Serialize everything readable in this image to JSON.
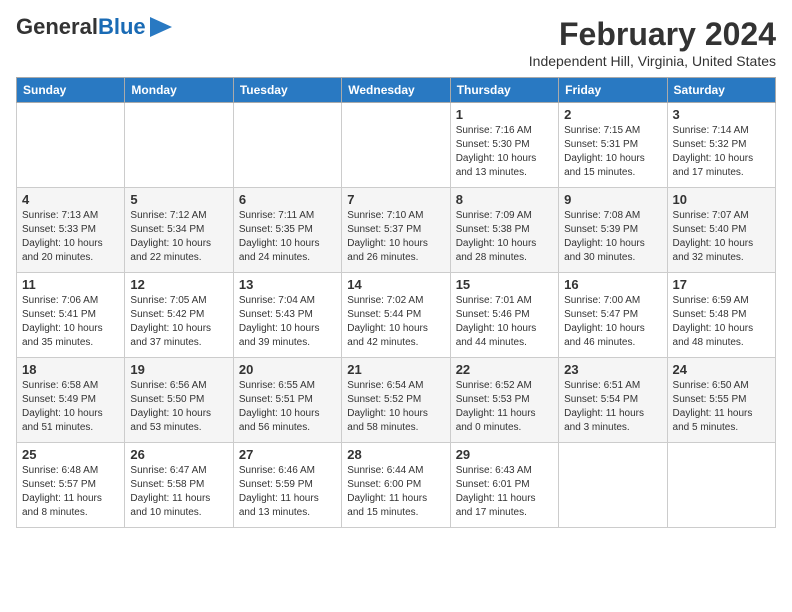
{
  "header": {
    "logo_general": "General",
    "logo_blue": "Blue",
    "month_title": "February 2024",
    "location": "Independent Hill, Virginia, United States"
  },
  "days_of_week": [
    "Sunday",
    "Monday",
    "Tuesday",
    "Wednesday",
    "Thursday",
    "Friday",
    "Saturday"
  ],
  "weeks": [
    [
      {
        "day": "",
        "info": ""
      },
      {
        "day": "",
        "info": ""
      },
      {
        "day": "",
        "info": ""
      },
      {
        "day": "",
        "info": ""
      },
      {
        "day": "1",
        "info": "Sunrise: 7:16 AM\nSunset: 5:30 PM\nDaylight: 10 hours\nand 13 minutes."
      },
      {
        "day": "2",
        "info": "Sunrise: 7:15 AM\nSunset: 5:31 PM\nDaylight: 10 hours\nand 15 minutes."
      },
      {
        "day": "3",
        "info": "Sunrise: 7:14 AM\nSunset: 5:32 PM\nDaylight: 10 hours\nand 17 minutes."
      }
    ],
    [
      {
        "day": "4",
        "info": "Sunrise: 7:13 AM\nSunset: 5:33 PM\nDaylight: 10 hours\nand 20 minutes."
      },
      {
        "day": "5",
        "info": "Sunrise: 7:12 AM\nSunset: 5:34 PM\nDaylight: 10 hours\nand 22 minutes."
      },
      {
        "day": "6",
        "info": "Sunrise: 7:11 AM\nSunset: 5:35 PM\nDaylight: 10 hours\nand 24 minutes."
      },
      {
        "day": "7",
        "info": "Sunrise: 7:10 AM\nSunset: 5:37 PM\nDaylight: 10 hours\nand 26 minutes."
      },
      {
        "day": "8",
        "info": "Sunrise: 7:09 AM\nSunset: 5:38 PM\nDaylight: 10 hours\nand 28 minutes."
      },
      {
        "day": "9",
        "info": "Sunrise: 7:08 AM\nSunset: 5:39 PM\nDaylight: 10 hours\nand 30 minutes."
      },
      {
        "day": "10",
        "info": "Sunrise: 7:07 AM\nSunset: 5:40 PM\nDaylight: 10 hours\nand 32 minutes."
      }
    ],
    [
      {
        "day": "11",
        "info": "Sunrise: 7:06 AM\nSunset: 5:41 PM\nDaylight: 10 hours\nand 35 minutes."
      },
      {
        "day": "12",
        "info": "Sunrise: 7:05 AM\nSunset: 5:42 PM\nDaylight: 10 hours\nand 37 minutes."
      },
      {
        "day": "13",
        "info": "Sunrise: 7:04 AM\nSunset: 5:43 PM\nDaylight: 10 hours\nand 39 minutes."
      },
      {
        "day": "14",
        "info": "Sunrise: 7:02 AM\nSunset: 5:44 PM\nDaylight: 10 hours\nand 42 minutes."
      },
      {
        "day": "15",
        "info": "Sunrise: 7:01 AM\nSunset: 5:46 PM\nDaylight: 10 hours\nand 44 minutes."
      },
      {
        "day": "16",
        "info": "Sunrise: 7:00 AM\nSunset: 5:47 PM\nDaylight: 10 hours\nand 46 minutes."
      },
      {
        "day": "17",
        "info": "Sunrise: 6:59 AM\nSunset: 5:48 PM\nDaylight: 10 hours\nand 48 minutes."
      }
    ],
    [
      {
        "day": "18",
        "info": "Sunrise: 6:58 AM\nSunset: 5:49 PM\nDaylight: 10 hours\nand 51 minutes."
      },
      {
        "day": "19",
        "info": "Sunrise: 6:56 AM\nSunset: 5:50 PM\nDaylight: 10 hours\nand 53 minutes."
      },
      {
        "day": "20",
        "info": "Sunrise: 6:55 AM\nSunset: 5:51 PM\nDaylight: 10 hours\nand 56 minutes."
      },
      {
        "day": "21",
        "info": "Sunrise: 6:54 AM\nSunset: 5:52 PM\nDaylight: 10 hours\nand 58 minutes."
      },
      {
        "day": "22",
        "info": "Sunrise: 6:52 AM\nSunset: 5:53 PM\nDaylight: 11 hours\nand 0 minutes."
      },
      {
        "day": "23",
        "info": "Sunrise: 6:51 AM\nSunset: 5:54 PM\nDaylight: 11 hours\nand 3 minutes."
      },
      {
        "day": "24",
        "info": "Sunrise: 6:50 AM\nSunset: 5:55 PM\nDaylight: 11 hours\nand 5 minutes."
      }
    ],
    [
      {
        "day": "25",
        "info": "Sunrise: 6:48 AM\nSunset: 5:57 PM\nDaylight: 11 hours\nand 8 minutes."
      },
      {
        "day": "26",
        "info": "Sunrise: 6:47 AM\nSunset: 5:58 PM\nDaylight: 11 hours\nand 10 minutes."
      },
      {
        "day": "27",
        "info": "Sunrise: 6:46 AM\nSunset: 5:59 PM\nDaylight: 11 hours\nand 13 minutes."
      },
      {
        "day": "28",
        "info": "Sunrise: 6:44 AM\nSunset: 6:00 PM\nDaylight: 11 hours\nand 15 minutes."
      },
      {
        "day": "29",
        "info": "Sunrise: 6:43 AM\nSunset: 6:01 PM\nDaylight: 11 hours\nand 17 minutes."
      },
      {
        "day": "",
        "info": ""
      },
      {
        "day": "",
        "info": ""
      }
    ]
  ]
}
